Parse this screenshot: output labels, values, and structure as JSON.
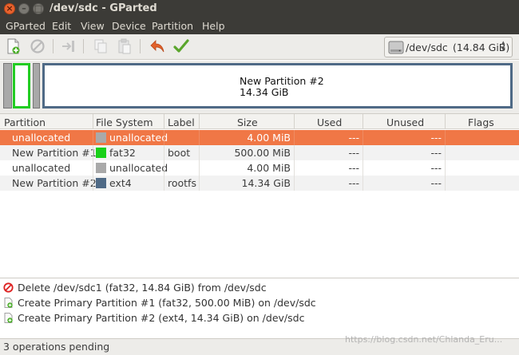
{
  "window": {
    "title": "/dev/sdc - GParted"
  },
  "menu": [
    "GParted",
    "Edit",
    "View",
    "Device",
    "Partition",
    "Help"
  ],
  "toolbar": {
    "tools": [
      "new-partition-icon",
      "delete-icon",
      "resize-move-icon",
      "copy-icon",
      "paste-icon",
      "undo-icon",
      "apply-icon"
    ],
    "device": {
      "name": "/dev/sdc",
      "size": "(14.84 GiB)"
    }
  },
  "graphic": {
    "main_label": "New Partition #2",
    "main_size": "14.34 GiB"
  },
  "table": {
    "headers": [
      "Partition",
      "File System",
      "Label",
      "Size",
      "Used",
      "Unused",
      "Flags"
    ],
    "rows": [
      {
        "partition": "unallocated",
        "fs": "unallocated",
        "fs_color": "#a9a9a9",
        "label": "",
        "size": "4.00 MiB",
        "used": "---",
        "unused": "---",
        "flags": "",
        "selected": true
      },
      {
        "partition": "New Partition #1",
        "fs": "fat32",
        "fs_color": "#18d018",
        "label": "boot",
        "size": "500.00 MiB",
        "used": "---",
        "unused": "---",
        "flags": "",
        "selected": false
      },
      {
        "partition": "unallocated",
        "fs": "unallocated",
        "fs_color": "#a9a9a9",
        "label": "",
        "size": "4.00 MiB",
        "used": "---",
        "unused": "---",
        "flags": "",
        "selected": false
      },
      {
        "partition": "New Partition #2",
        "fs": "ext4",
        "fs_color": "#4f6a86",
        "label": "rootfs",
        "size": "14.34 GiB",
        "used": "---",
        "unused": "---",
        "flags": "",
        "selected": false
      }
    ]
  },
  "operations": [
    {
      "icon": "delete-icon",
      "text": "Delete /dev/sdc1 (fat32, 14.84 GiB) from /dev/sdc"
    },
    {
      "icon": "new-partition-icon",
      "text": "Create Primary Partition #1 (fat32, 500.00 MiB) on /dev/sdc"
    },
    {
      "icon": "new-partition-icon",
      "text": "Create Primary Partition #2 (ext4, 14.34 GiB) on /dev/sdc"
    }
  ],
  "status": "3 operations pending",
  "watermark": "https://blog.csdn.net/Chlanda_Eru..."
}
